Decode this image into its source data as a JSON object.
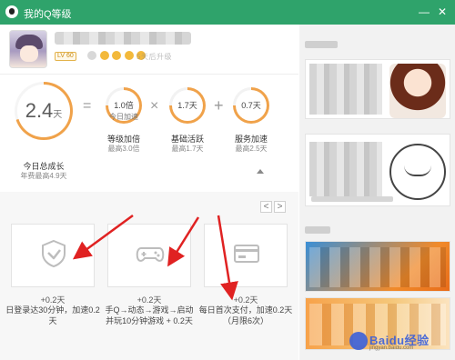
{
  "window": {
    "title": "我的Q等级",
    "minimize_glyph": "—",
    "close_glyph": "✕"
  },
  "profile": {
    "level_badge": "LV 60",
    "days_text": "5天后升级"
  },
  "speed": {
    "total": {
      "value": "2.4",
      "unit": "天",
      "label": "今日总成长",
      "sub": "年费最高4.9天"
    },
    "eq": "=",
    "x": "×",
    "plus": "+",
    "items": [
      {
        "value": "1.0倍",
        "inner_sub": "今日加速",
        "label": "等级加倍",
        "sub": "最高3.0倍"
      },
      {
        "value": "1.7天",
        "label": "基础活跃",
        "sub": "最高1.7天"
      },
      {
        "value": "0.7天",
        "label": "服务加速",
        "sub": "最高2.5天"
      }
    ]
  },
  "tasks": {
    "pager": {
      "prev": "<",
      "next": ">"
    },
    "items": [
      {
        "bonus": "+0.2天",
        "desc": "日登录达30分钟，加速0.2天",
        "icon": "shield-check-icon"
      },
      {
        "bonus": "+0.2天",
        "desc": "手Q→动态→游戏→启动并玩10分钟游戏 + 0.2天",
        "icon": "gamepad-icon"
      },
      {
        "bonus": "+0.2天",
        "desc": "每日首次支付，加速0.2天（月限6次）",
        "icon": "card-icon"
      }
    ]
  },
  "watermark": {
    "brand": "Baidu经验",
    "url": "jingyan.baidu.com"
  },
  "colors": {
    "titlebar": "#2fa36b",
    "ring": "#f0a24a",
    "arrow": "#e02222"
  }
}
